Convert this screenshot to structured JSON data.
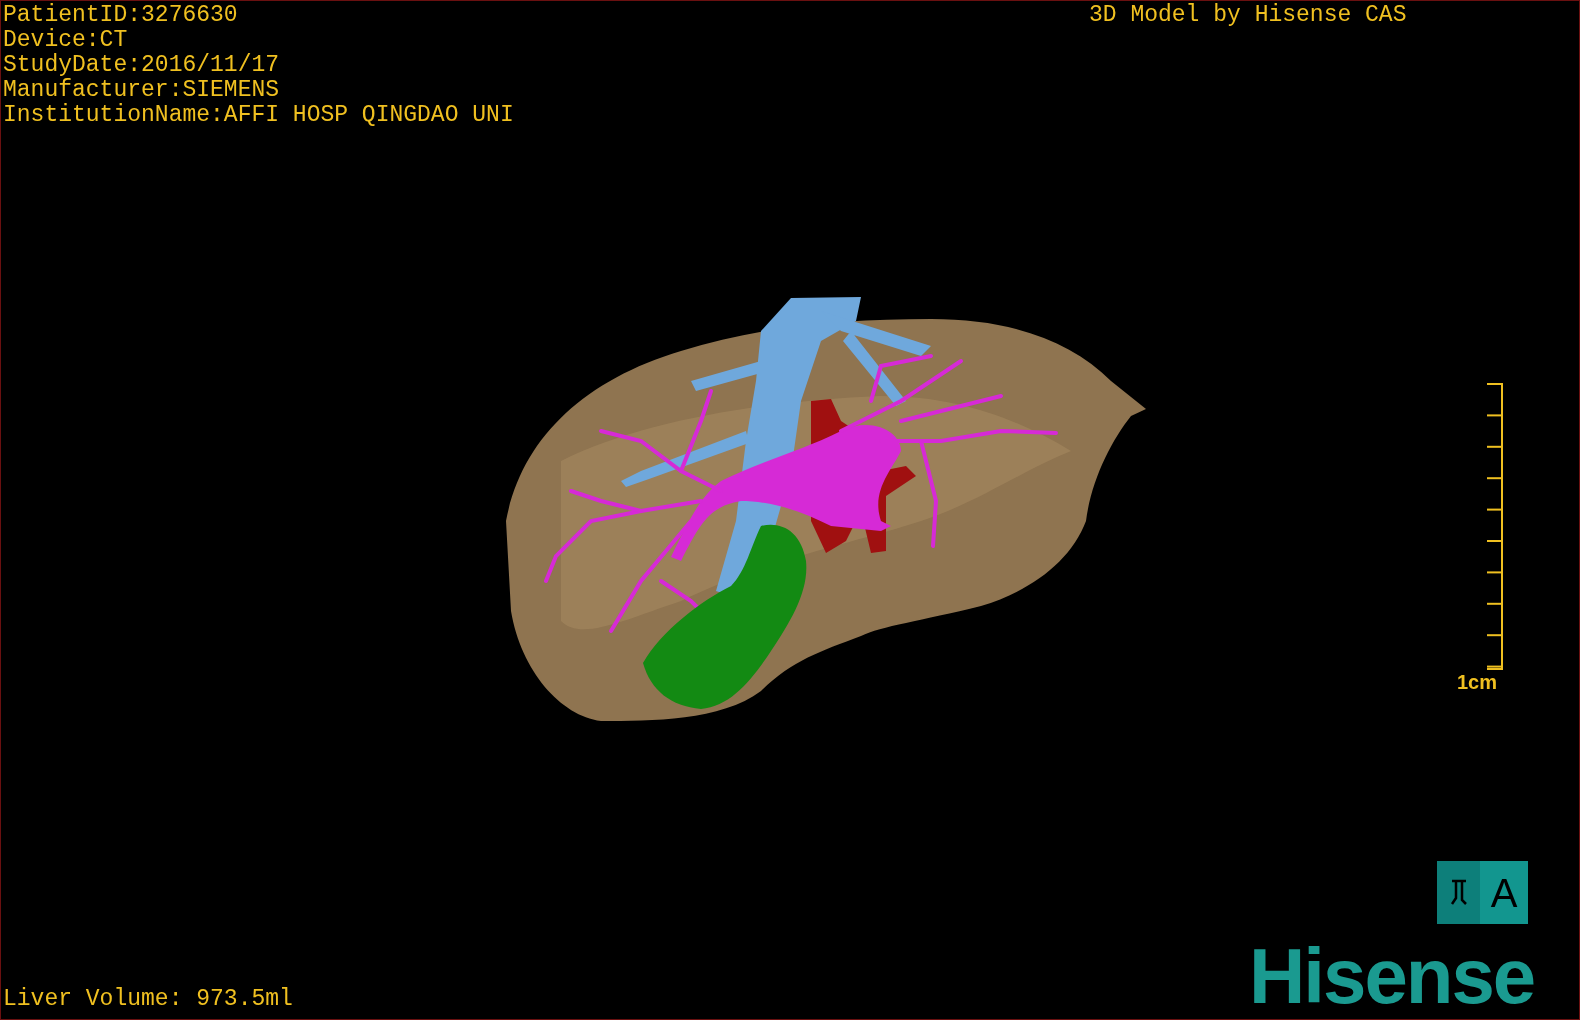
{
  "patient_info": [
    "PatientID:3276630",
    "Device:CT",
    "StudyDate:2016/11/17",
    "Manufacturer:SIEMENS",
    "InstitutionName:AFFI HOSP QINGDAO UNI"
  ],
  "title": "3D Model by Hisense CAS",
  "scale_bar": {
    "label": "1cm"
  },
  "orientation_cube": {
    "front_label": "A"
  },
  "logo": "Hisense",
  "liver_volume": "Liver Volume: 973.5ml"
}
